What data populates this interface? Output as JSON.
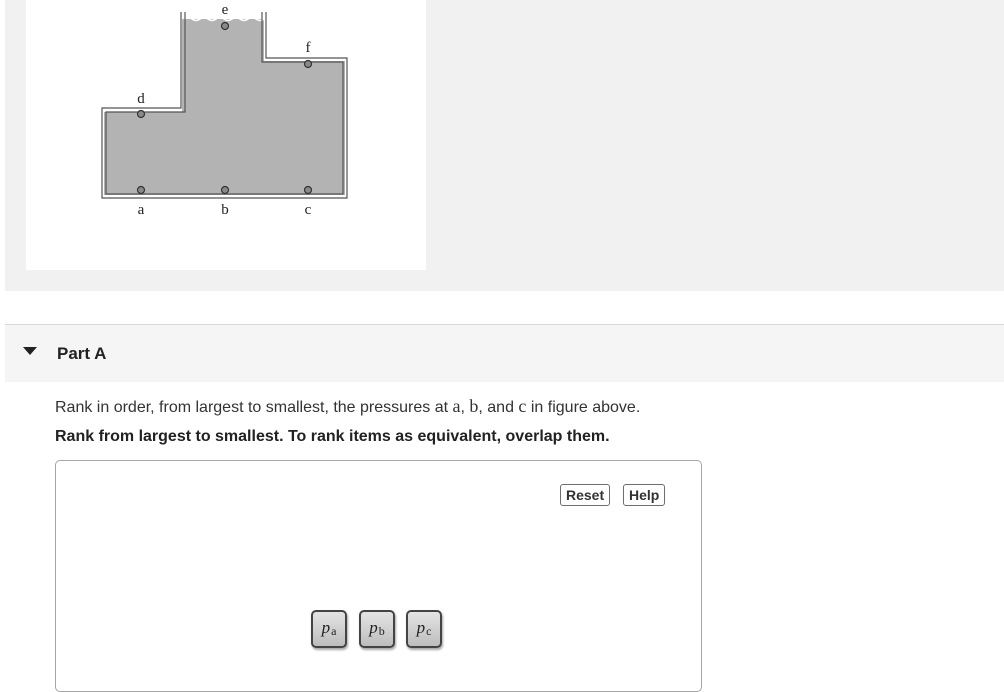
{
  "figure": {
    "points": [
      {
        "id": "a",
        "label": "a"
      },
      {
        "id": "b",
        "label": "b"
      },
      {
        "id": "c",
        "label": "c"
      },
      {
        "id": "d",
        "label": "d"
      },
      {
        "id": "e",
        "label": "e"
      },
      {
        "id": "f",
        "label": "f"
      }
    ],
    "liquid_color": "#b3b3b3",
    "wall_color": "#555555"
  },
  "part": {
    "title": "Part A",
    "question_prefix": "Rank in order, from largest to smallest, the pressures at ",
    "var_a": "a",
    "sep1": ", ",
    "var_b": "b",
    "sep2": ", and ",
    "var_c": "c",
    "question_suffix": " in figure above.",
    "instruction": "Rank from largest to smallest. To rank items as equivalent, overlap them.",
    "reset_label": "Reset",
    "help_label": "Help",
    "tiles": [
      {
        "symbol": "p",
        "subscript": "a"
      },
      {
        "symbol": "p",
        "subscript": "b"
      },
      {
        "symbol": "p",
        "subscript": "c"
      }
    ]
  }
}
